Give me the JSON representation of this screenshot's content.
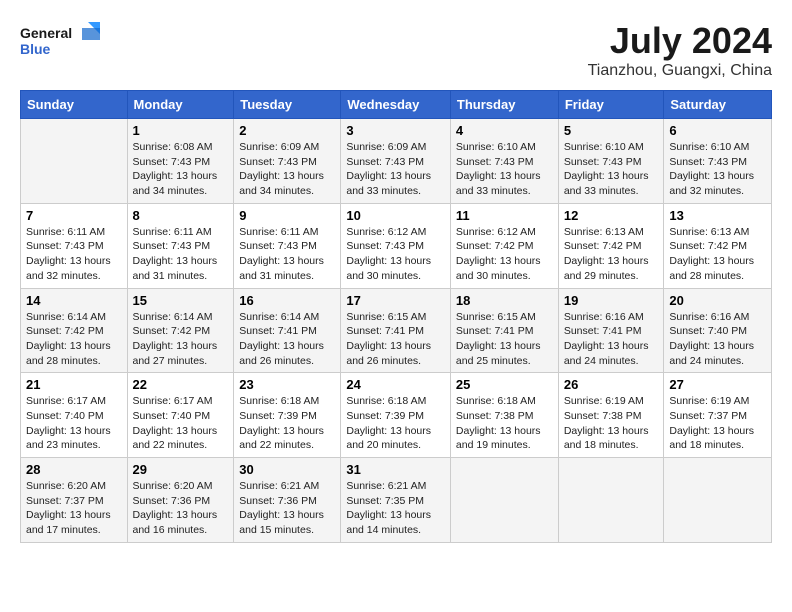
{
  "header": {
    "logo_line1": "General",
    "logo_line2": "Blue",
    "month_year": "July 2024",
    "location": "Tianzhou, Guangxi, China"
  },
  "days_of_week": [
    "Sunday",
    "Monday",
    "Tuesday",
    "Wednesday",
    "Thursday",
    "Friday",
    "Saturday"
  ],
  "weeks": [
    [
      {
        "day": "",
        "info": ""
      },
      {
        "day": "1",
        "info": "Sunrise: 6:08 AM\nSunset: 7:43 PM\nDaylight: 13 hours\nand 34 minutes."
      },
      {
        "day": "2",
        "info": "Sunrise: 6:09 AM\nSunset: 7:43 PM\nDaylight: 13 hours\nand 34 minutes."
      },
      {
        "day": "3",
        "info": "Sunrise: 6:09 AM\nSunset: 7:43 PM\nDaylight: 13 hours\nand 33 minutes."
      },
      {
        "day": "4",
        "info": "Sunrise: 6:10 AM\nSunset: 7:43 PM\nDaylight: 13 hours\nand 33 minutes."
      },
      {
        "day": "5",
        "info": "Sunrise: 6:10 AM\nSunset: 7:43 PM\nDaylight: 13 hours\nand 33 minutes."
      },
      {
        "day": "6",
        "info": "Sunrise: 6:10 AM\nSunset: 7:43 PM\nDaylight: 13 hours\nand 32 minutes."
      }
    ],
    [
      {
        "day": "7",
        "info": "Sunrise: 6:11 AM\nSunset: 7:43 PM\nDaylight: 13 hours\nand 32 minutes."
      },
      {
        "day": "8",
        "info": "Sunrise: 6:11 AM\nSunset: 7:43 PM\nDaylight: 13 hours\nand 31 minutes."
      },
      {
        "day": "9",
        "info": "Sunrise: 6:11 AM\nSunset: 7:43 PM\nDaylight: 13 hours\nand 31 minutes."
      },
      {
        "day": "10",
        "info": "Sunrise: 6:12 AM\nSunset: 7:43 PM\nDaylight: 13 hours\nand 30 minutes."
      },
      {
        "day": "11",
        "info": "Sunrise: 6:12 AM\nSunset: 7:42 PM\nDaylight: 13 hours\nand 30 minutes."
      },
      {
        "day": "12",
        "info": "Sunrise: 6:13 AM\nSunset: 7:42 PM\nDaylight: 13 hours\nand 29 minutes."
      },
      {
        "day": "13",
        "info": "Sunrise: 6:13 AM\nSunset: 7:42 PM\nDaylight: 13 hours\nand 28 minutes."
      }
    ],
    [
      {
        "day": "14",
        "info": "Sunrise: 6:14 AM\nSunset: 7:42 PM\nDaylight: 13 hours\nand 28 minutes."
      },
      {
        "day": "15",
        "info": "Sunrise: 6:14 AM\nSunset: 7:42 PM\nDaylight: 13 hours\nand 27 minutes."
      },
      {
        "day": "16",
        "info": "Sunrise: 6:14 AM\nSunset: 7:41 PM\nDaylight: 13 hours\nand 26 minutes."
      },
      {
        "day": "17",
        "info": "Sunrise: 6:15 AM\nSunset: 7:41 PM\nDaylight: 13 hours\nand 26 minutes."
      },
      {
        "day": "18",
        "info": "Sunrise: 6:15 AM\nSunset: 7:41 PM\nDaylight: 13 hours\nand 25 minutes."
      },
      {
        "day": "19",
        "info": "Sunrise: 6:16 AM\nSunset: 7:41 PM\nDaylight: 13 hours\nand 24 minutes."
      },
      {
        "day": "20",
        "info": "Sunrise: 6:16 AM\nSunset: 7:40 PM\nDaylight: 13 hours\nand 24 minutes."
      }
    ],
    [
      {
        "day": "21",
        "info": "Sunrise: 6:17 AM\nSunset: 7:40 PM\nDaylight: 13 hours\nand 23 minutes."
      },
      {
        "day": "22",
        "info": "Sunrise: 6:17 AM\nSunset: 7:40 PM\nDaylight: 13 hours\nand 22 minutes."
      },
      {
        "day": "23",
        "info": "Sunrise: 6:18 AM\nSunset: 7:39 PM\nDaylight: 13 hours\nand 22 minutes."
      },
      {
        "day": "24",
        "info": "Sunrise: 6:18 AM\nSunset: 7:39 PM\nDaylight: 13 hours\nand 20 minutes."
      },
      {
        "day": "25",
        "info": "Sunrise: 6:18 AM\nSunset: 7:38 PM\nDaylight: 13 hours\nand 19 minutes."
      },
      {
        "day": "26",
        "info": "Sunrise: 6:19 AM\nSunset: 7:38 PM\nDaylight: 13 hours\nand 18 minutes."
      },
      {
        "day": "27",
        "info": "Sunrise: 6:19 AM\nSunset: 7:37 PM\nDaylight: 13 hours\nand 18 minutes."
      }
    ],
    [
      {
        "day": "28",
        "info": "Sunrise: 6:20 AM\nSunset: 7:37 PM\nDaylight: 13 hours\nand 17 minutes."
      },
      {
        "day": "29",
        "info": "Sunrise: 6:20 AM\nSunset: 7:36 PM\nDaylight: 13 hours\nand 16 minutes."
      },
      {
        "day": "30",
        "info": "Sunrise: 6:21 AM\nSunset: 7:36 PM\nDaylight: 13 hours\nand 15 minutes."
      },
      {
        "day": "31",
        "info": "Sunrise: 6:21 AM\nSunset: 7:35 PM\nDaylight: 13 hours\nand 14 minutes."
      },
      {
        "day": "",
        "info": ""
      },
      {
        "day": "",
        "info": ""
      },
      {
        "day": "",
        "info": ""
      }
    ]
  ]
}
